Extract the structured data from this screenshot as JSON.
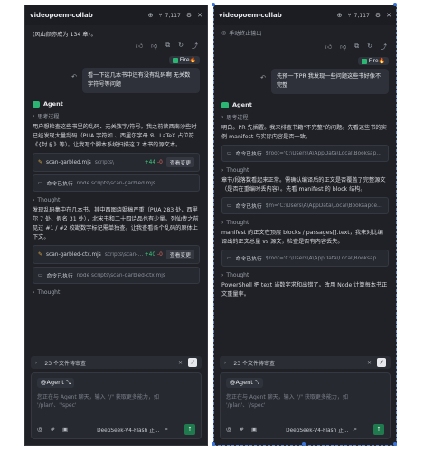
{
  "app": {
    "title": "videopoem-collab",
    "count": "7,117"
  },
  "left": {
    "intro_text": "(风山颜亦成为 134 章）。",
    "user": "Fire",
    "user_message": "看一下这几本书中还有没有乱码啊 无关数字符号等问题",
    "agent_label": "Agent",
    "think_label": "思考过程",
    "reply1": "用户想检查这些书里的乱码、无关数字/符号。我之前读西南沙些时已经发现大量乱码（PUA 字符如  、西里尔字母 Я、LaTeX 占位符《{封 § 》等）。让我写个脚本系统扫描这 7 本书的源文本。",
    "card1": {
      "name": "scan-garbled.mjs",
      "path": "scripts\\",
      "plus": "+44",
      "minus": "-0",
      "view": "查看变更"
    },
    "cmd1": {
      "label": "命令已执行",
      "path": "node scripts\\scan-garbled.mjs"
    },
    "thought_label": "Thought",
    "reply2": "发现乱码集中在几本书。其中西图烧姻稿严重（PUA 283 处、西里尔 7 处、假名 31 处），北宋书和二十四诗品也有少量。列仙传之前见过 #1 / #2 校勘数字标记需单独查。让我查看各个乱码的原体上下文。",
    "card2": {
      "name": "scan-garbled-ctx.mjs",
      "path": "scripts\\scan-garb...",
      "plus": "+40",
      "minus": "-0",
      "view": "查看变更"
    },
    "cmd2": {
      "label": "命令已执行",
      "path": "node scripts\\scan-garbled-ctx.mjs"
    },
    "thought2_label": "Thought"
  },
  "right": {
    "stop_label": "手动终止输出",
    "user": "Fire",
    "user_message": "先预一下PR 我发现一些问题这些书好像不完整",
    "agent_label": "Agent",
    "think_label": "思考过程",
    "reply1": "明白。PR 先搁置。我来排查书籍\"不完整\"的问题。先看这些书的实例 manifest 与实际内容是否一致。",
    "cmd1": {
      "label": "命令已执行",
      "path": "$root='C:\\Users\\A\\AppData\\Local\\BooksapceTe..."
    },
    "thought_label": "Thought",
    "reply2": "章节/段落数看起来正常。需确认编译后的正文是否覆盖了完整源文（是否在重编时丢内容）。先看 manifest 的 block 结构。",
    "cmd2": {
      "label": "命令已执行",
      "path": "$m='C:\\Users\\A\\AppData\\Local\\BooksapceTe..."
    },
    "thought2_label": "Thought",
    "reply3": "manifest 的正文在顶层 blocks / passages[].text，我来对比编译出的正文总量 vs 源文，检查是否有内容丢失。",
    "cmd3": {
      "label": "命令已执行",
      "path": "$root='C:\\Users\\A\\AppData\\Local\\BooksapceTe..."
    },
    "thought3_label": "Thought",
    "reply4": "PowerShell 把 text 当数字求和出错了。改用 Node 计算每本书正文重量率。"
  },
  "composer": {
    "pending": "23 个文件待审查",
    "mention": "@Agent",
    "placeholder": "您正在与 Agent 聊天，输入 \"/\" 获取更多能力，如 '/plan'、'/spec'",
    "model": "DeepSeek-V4-Flash 正..."
  },
  "colors": {
    "accent_green": "#2bb673",
    "send_green": "#1f7a4d",
    "panel_bg": "#1f2126"
  }
}
